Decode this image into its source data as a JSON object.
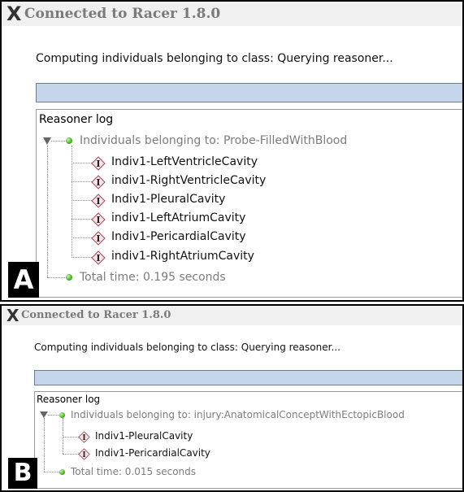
{
  "panels": [
    {
      "label": "A",
      "window_title": "Connected to Racer 1.8.0",
      "status_text": "Computing individuals belonging to class: Querying reasoner...",
      "log_title": "Reasoner log",
      "query_header": "Individuals belonging to: Probe-FilledWithBlood",
      "individuals": [
        "Indiv1-LeftVentricleCavity",
        "indiv1-RightVentricleCavity",
        "Indiv1-PleuralCavity",
        "indiv1-LeftAtriumCavity",
        "Indiv1-PericardialCavity",
        "indiv1-RightAtriumCavity"
      ],
      "total_time": "Total time: 0.195 seconds"
    },
    {
      "label": "B",
      "window_title": "Connected to Racer 1.8.0",
      "status_text": "Computing individuals belonging to class: Querying reasoner...",
      "log_title": "Reasoner log",
      "query_header": "Individuals belonging to: injury:AnatomicalConceptWithEctopicBlood",
      "individuals": [
        "Indiv1-PleuralCavity",
        "Indiv1-PericardialCavity"
      ],
      "total_time": "Total time: 0.015 seconds"
    }
  ],
  "icons": {
    "window_icon": "x-window-icon",
    "tree_toggle": "expanded-triangle-icon",
    "query_node": "green-dot-icon",
    "individual_node": "individual-diamond-icon"
  },
  "colors": {
    "progress_fill": "#c6d6ea",
    "muted_text": "#7c7c7c",
    "green_dot": "#3fb51a",
    "diamond_fill": "#f7e3e6",
    "diamond_border": "#a04a5a"
  }
}
